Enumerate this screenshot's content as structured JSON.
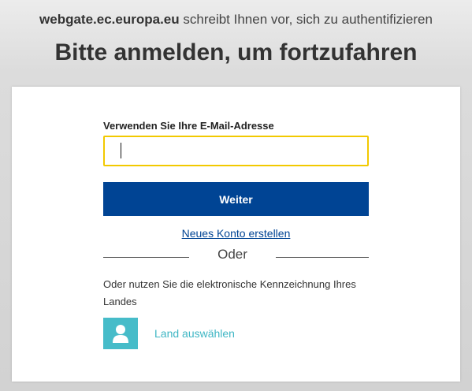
{
  "header": {
    "domain": "webgate.ec.europa.eu",
    "auth_message": " schreibt Ihnen vor, sich zu authentifizieren",
    "title": "Bitte anmelden, um fortzufahren"
  },
  "login": {
    "email_label": "Verwenden Sie Ihre E-Mail-Adresse",
    "email_value": "",
    "submit_label": "Weiter",
    "create_account_label": "Neues Konto erstellen",
    "divider_text": "Oder",
    "eid_text": "Oder nutzen Sie die elektronische Kennzeichnung Ihres Landes",
    "select_country_label": "Land auswählen"
  },
  "colors": {
    "primary": "#004494",
    "input_focus_border": "#f2c900",
    "teal_accent": "#46bcc9"
  },
  "icons": {
    "country": "user-icon"
  }
}
